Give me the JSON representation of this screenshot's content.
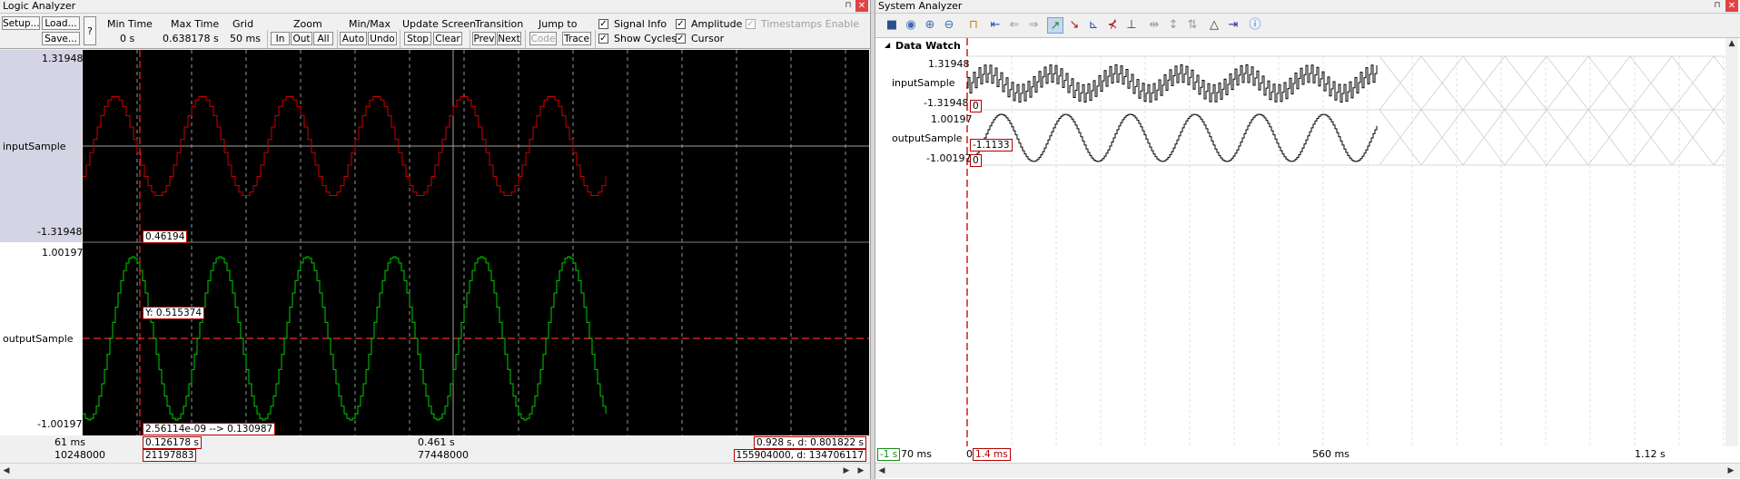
{
  "logic_analyzer": {
    "window_title": "Logic Analyzer",
    "buttons": {
      "setup": "Setup...",
      "load": "Load...",
      "save": "Save...",
      "help": "?"
    },
    "min_time": {
      "header": "Min Time",
      "value": "0 s"
    },
    "max_time": {
      "header": "Max Time",
      "value": "0.638178 s"
    },
    "grid": {
      "header": "Grid",
      "value": "50 ms"
    },
    "zoom": {
      "header": "Zoom",
      "in": "In",
      "out": "Out",
      "all": "All"
    },
    "minmax": {
      "header": "Min/Max",
      "auto": "Auto",
      "undo": "Undo"
    },
    "update_screen": {
      "header": "Update Screen",
      "stop": "Stop",
      "clear": "Clear"
    },
    "transition": {
      "header": "Transition",
      "prev": "Prev",
      "next": "Next"
    },
    "jump_to": {
      "header": "Jump to",
      "code": "Code",
      "trace": "Trace"
    },
    "checkboxes": {
      "signal_info": {
        "label": "Signal Info",
        "checked": true
      },
      "show_cycles": {
        "label": "Show Cycles",
        "checked": true
      },
      "amplitude": {
        "label": "Amplitude",
        "checked": true
      },
      "cursor": {
        "label": "Cursor",
        "checked": true
      },
      "timestamps_enable": {
        "label": "Timestamps Enable",
        "checked": true,
        "disabled": true
      }
    },
    "signals": [
      {
        "name": "inputSample",
        "max": "1.31948",
        "min": "-1.31948",
        "color": "#cc0000"
      },
      {
        "name": "outputSample",
        "max": "1.00197",
        "min": "-1.00197",
        "color": "#00cc00"
      }
    ],
    "cursor_labels": {
      "input_value": "0.46194",
      "output_y": "Y: 0.515374",
      "delta": "2.56114e-09 --> 0.130987",
      "cursor_time": "0.126178 s",
      "cursor_cycles": "21197883"
    },
    "time_axis": {
      "left_time": "61 ms",
      "left_cycles": "10248000",
      "center_time": "0.461 s",
      "center_cycles": "77448000",
      "right_time": "0.928 s,  d: 0.801822 s",
      "right_cycles": "155904000,  d: 134706117"
    }
  },
  "system_analyzer": {
    "window_title": "System Analyzer",
    "toolbar_icons": [
      "save-icon",
      "zoom-fit-icon",
      "zoom-in-icon",
      "zoom-out-icon",
      "unlock-icon",
      "jump-start-icon",
      "back-icon",
      "forward-icon",
      "rising-edge-icon",
      "falling-edge-icon",
      "prev-edge-icon",
      "next-edge-icon",
      "cursor-icon",
      "expand-icon",
      "fit-vertical-icon",
      "sort-icon",
      "delta-icon",
      "jump-end-icon",
      "help-icon"
    ],
    "group_label": "Data Watch",
    "signals": [
      {
        "name": "inputSample",
        "max": "1.31948",
        "min": "-1.31948",
        "cursor_value": "0"
      },
      {
        "name": "outputSample",
        "max": "1.00197",
        "min": "-1.00197",
        "cursor_value": "0",
        "marker_value": "-1.1133"
      }
    ],
    "time_axis": {
      "left_offset": "-1 s",
      "left_time": "70 ms",
      "cursor_marker": "0",
      "cursor_time": "1.4 ms",
      "mid_time": "560 ms",
      "right_time": "1.12 s"
    }
  }
}
